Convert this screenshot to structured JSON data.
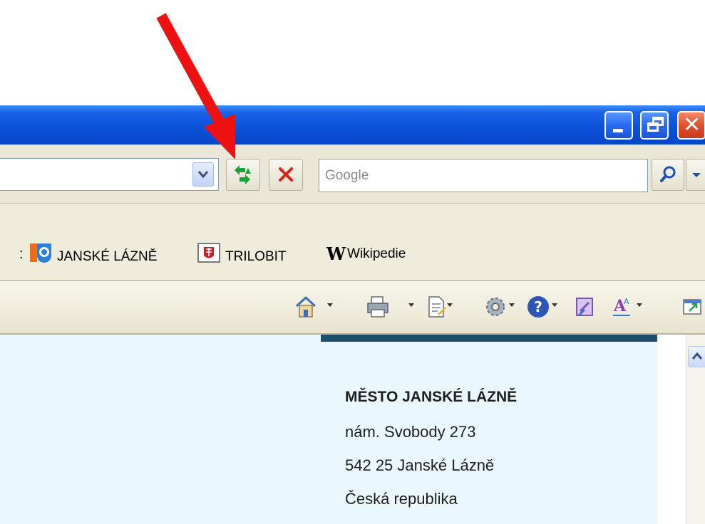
{
  "search": {
    "placeholder": "Google"
  },
  "links": [
    {
      "label": "JANSKÉ LÁZNĚ",
      "icon": "janske-lazne-crest-icon"
    },
    {
      "label": "TRILOBIT",
      "icon": "trilobit-logo-icon"
    },
    {
      "label": "Wikipedie",
      "icon": "wikipedia-w-icon"
    }
  ],
  "links_separator": ":",
  "toolbar_icons": [
    "home-icon",
    "print-icon",
    "page-icon",
    "tools-gear-icon",
    "help-icon",
    "research-icon",
    "font-size-icon",
    "popout-icon"
  ],
  "card": {
    "name": "MĚSTO JANSKÉ LÁZNĚ",
    "street": "nám. Svobody 273",
    "city": "542 25  Janské Lázně",
    "country": "Česká republika"
  },
  "colors": {
    "titlebar": "#0a53d8",
    "annotation_arrow": "#ee1111",
    "card_border": "#1d4f6d"
  }
}
